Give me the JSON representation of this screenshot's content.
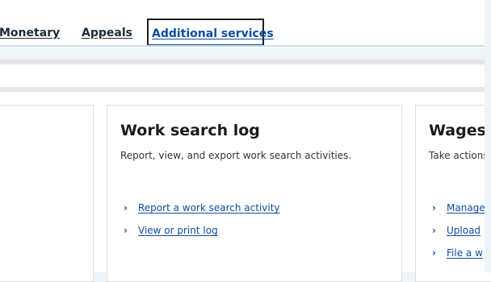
{
  "tabs": {
    "items": [
      {
        "label": "Monetary"
      },
      {
        "label": "Appeals"
      },
      {
        "label": "Additional services"
      }
    ]
  },
  "cards": [
    {
      "title": "Work search log",
      "description": "Report, view, and export work search activities.",
      "links": [
        {
          "label": "Report a work search activity"
        },
        {
          "label": "View or print log"
        }
      ]
    },
    {
      "title": "Wages",
      "description": "Take actions",
      "links": [
        {
          "label": "Manage"
        },
        {
          "label": "Upload"
        },
        {
          "label": "File a w"
        }
      ]
    }
  ],
  "icons": {
    "link_chevron": "chevron-right-icon"
  },
  "colors": {
    "link": "#0b4ea2",
    "tab_underline": "#c9dbef",
    "background": "#eef4f7"
  }
}
